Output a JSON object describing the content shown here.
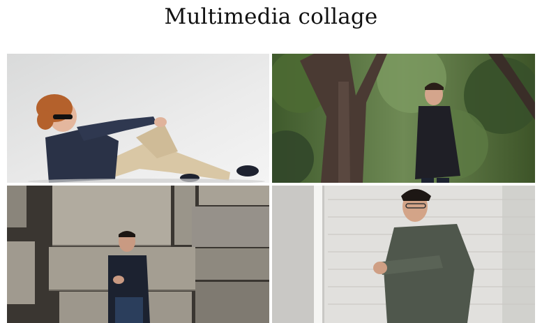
{
  "page": {
    "title": "Multimedia collage"
  },
  "gallery": {
    "images": [
      {
        "subject": "man with curly red hair and sunglasses reclining on studio floor",
        "bg": "#e6e7e7"
      },
      {
        "subject": "man in black turtleneck standing beside tree in park",
        "bg": "#4f6a3a"
      },
      {
        "subject": "man in dark sweater leaning against stone blocks",
        "bg": "#8d877c"
      },
      {
        "subject": "man with glasses checking wristwatch against white brick wall",
        "bg": "#dcdcda"
      }
    ]
  }
}
